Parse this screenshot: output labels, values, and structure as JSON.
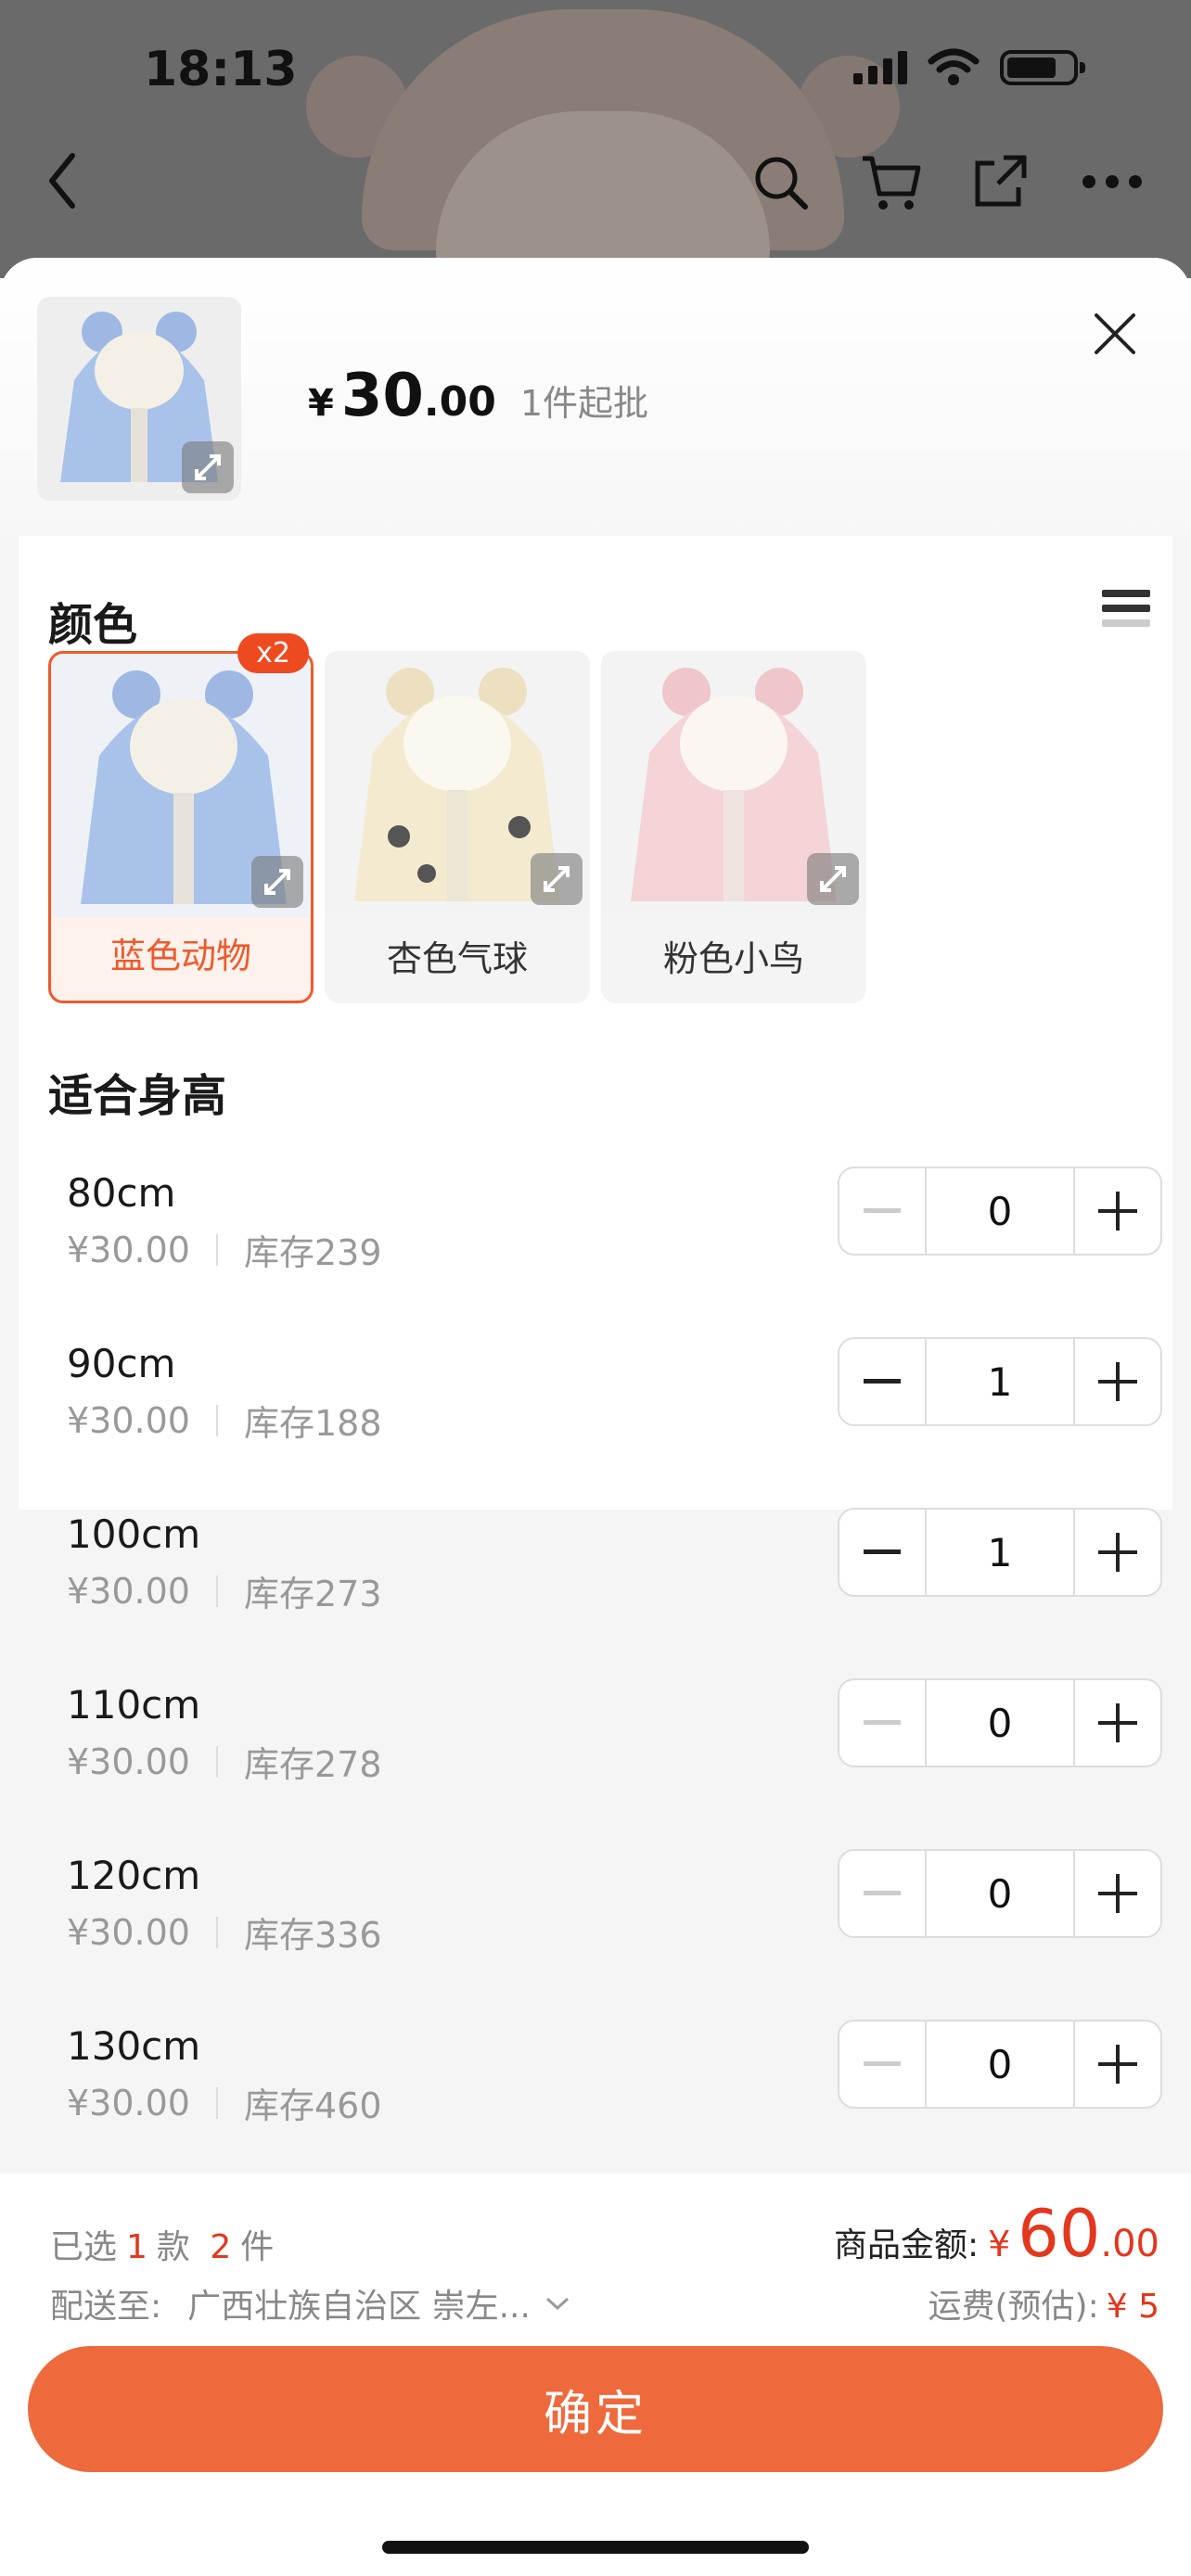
{
  "status_bar": {
    "time": "18:13"
  },
  "header": {
    "currency": "¥",
    "price_int": "30",
    "price_dec": ".00",
    "min_order": "1件起批"
  },
  "colors": {
    "title": "颜色",
    "items": [
      {
        "label": "蓝色动物",
        "badge": "x2",
        "selected": true,
        "swatch": "#a9c2ea"
      },
      {
        "label": "杏色气球",
        "selected": false,
        "swatch": "#f3ead0"
      },
      {
        "label": "粉色小鸟",
        "selected": false,
        "swatch": "#f4d4d6"
      }
    ]
  },
  "sizes": {
    "title": "适合身高",
    "rows": [
      {
        "name": "80cm",
        "price": "¥30.00",
        "stock": "库存239",
        "qty": "0"
      },
      {
        "name": "90cm",
        "price": "¥30.00",
        "stock": "库存188",
        "qty": "1"
      },
      {
        "name": "100cm",
        "price": "¥30.00",
        "stock": "库存273",
        "qty": "1"
      },
      {
        "name": "110cm",
        "price": "¥30.00",
        "stock": "库存278",
        "qty": "0"
      },
      {
        "name": "120cm",
        "price": "¥30.00",
        "stock": "库存336",
        "qty": "0"
      },
      {
        "name": "130cm",
        "price": "¥30.00",
        "stock": "库存460",
        "qty": "0"
      }
    ]
  },
  "footer": {
    "selected_prefix": "已选",
    "selected_styles": "1",
    "styles_unit": "款",
    "selected_pieces": "2",
    "pieces_unit": "件",
    "amount_label": "商品金额:",
    "amount_currency": "¥",
    "amount_int": "60",
    "amount_dec": ".00",
    "ship_label": "配送至:",
    "ship_address": "广西壮族自治区 崇左...",
    "shipping_label": "运费(预估):",
    "shipping_value": "¥ 5",
    "confirm_label": "确定"
  },
  "theme": {
    "accent": "#ee6a3c",
    "price_red": "#e3371e"
  }
}
